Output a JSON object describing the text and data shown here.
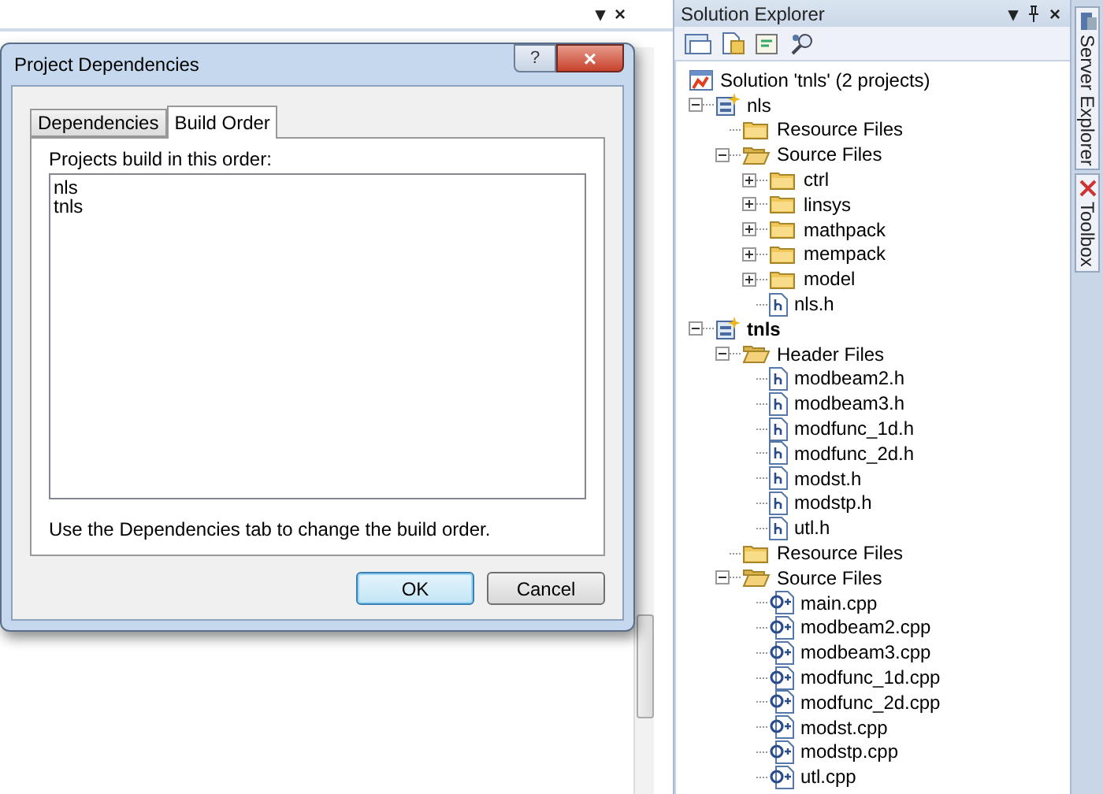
{
  "editor": {
    "header_buttons": [
      "▾",
      "×"
    ]
  },
  "dialog": {
    "title": "Project Dependencies",
    "help_button": "?",
    "close_button": "×",
    "tabs": [
      {
        "label": "Dependencies",
        "selected": false
      },
      {
        "label": "Build Order",
        "selected": true
      }
    ],
    "list_label": "Projects build in this order:",
    "projects": [
      "nls",
      "tnls"
    ],
    "hint": "Use the Dependencies tab to change the build order.",
    "buttons": [
      {
        "label": "OK",
        "default": true
      },
      {
        "label": "Cancel",
        "default": false
      }
    ]
  },
  "solution_explorer": {
    "title": "Solution Explorer",
    "header_buttons": [
      "▾",
      "×"
    ],
    "tree": [
      {
        "kind": "solution",
        "label": "Solution 'tnls' (2 projects)",
        "children": [
          {
            "kind": "project",
            "label": "nls",
            "startup": false,
            "expanded": true,
            "children": [
              {
                "kind": "folder",
                "label": "Resource Files"
              },
              {
                "kind": "folder",
                "label": "Source Files",
                "expanded": true,
                "children": [
                  {
                    "kind": "folder",
                    "label": "ctrl",
                    "expanded": false
                  },
                  {
                    "kind": "folder",
                    "label": "linsys",
                    "expanded": false
                  },
                  {
                    "kind": "folder",
                    "label": "mathpack",
                    "expanded": false
                  },
                  {
                    "kind": "folder",
                    "label": "mempack",
                    "expanded": false
                  },
                  {
                    "kind": "folder",
                    "label": "model",
                    "expanded": false
                  },
                  {
                    "kind": "header",
                    "label": "nls.h"
                  }
                ]
              }
            ]
          },
          {
            "kind": "project",
            "label": "tnls",
            "startup": true,
            "expanded": true,
            "children": [
              {
                "kind": "folder",
                "label": "Header Files",
                "expanded": true,
                "children": [
                  {
                    "kind": "header",
                    "label": "modbeam2.h"
                  },
                  {
                    "kind": "header",
                    "label": "modbeam3.h"
                  },
                  {
                    "kind": "header",
                    "label": "modfunc_1d.h"
                  },
                  {
                    "kind": "header",
                    "label": "modfunc_2d.h"
                  },
                  {
                    "kind": "header",
                    "label": "modst.h"
                  },
                  {
                    "kind": "header",
                    "label": "modstp.h"
                  },
                  {
                    "kind": "header",
                    "label": "utl.h"
                  }
                ]
              },
              {
                "kind": "folder",
                "label": "Resource Files"
              },
              {
                "kind": "folder",
                "label": "Source Files",
                "expanded": true,
                "children": [
                  {
                    "kind": "cpp",
                    "label": "main.cpp"
                  },
                  {
                    "kind": "cpp",
                    "label": "modbeam2.cpp"
                  },
                  {
                    "kind": "cpp",
                    "label": "modbeam3.cpp"
                  },
                  {
                    "kind": "cpp",
                    "label": "modfunc_1d.cpp"
                  },
                  {
                    "kind": "cpp",
                    "label": "modfunc_2d.cpp"
                  },
                  {
                    "kind": "cpp",
                    "label": "modst.cpp"
                  },
                  {
                    "kind": "cpp",
                    "label": "modstp.cpp"
                  },
                  {
                    "kind": "cpp",
                    "label": "utl.cpp"
                  }
                ]
              }
            ]
          }
        ]
      }
    ]
  },
  "side_tabs": [
    {
      "label": "Server Explorer"
    },
    {
      "label": "Toolbox"
    }
  ]
}
